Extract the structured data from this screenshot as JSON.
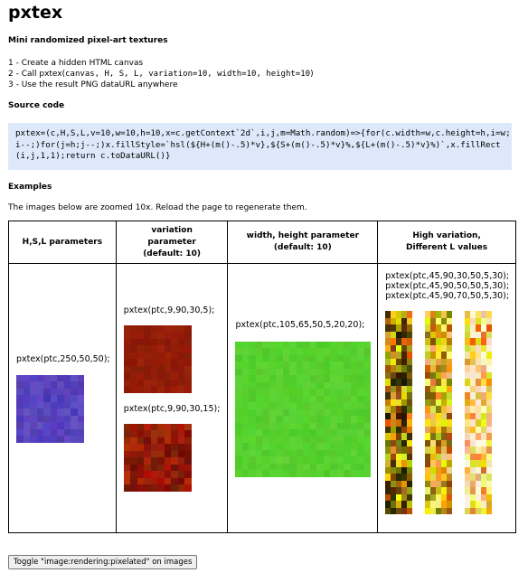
{
  "title": "pxtex",
  "subtitle": "Mini randomized pixel-art textures",
  "steps": {
    "s1": "1 - Create a hidden HTML canvas",
    "s2_prefix": "2 - Call pxtex(",
    "s2_args": "canvas, H, S, L, variation=10, width=10, height=10",
    "s2_suffix": ")",
    "s3": "3 - Use the result PNG dataURL anywhere"
  },
  "source_heading": "Source code",
  "source_code": "pxtex=(c,H,S,L,v=10,w=10,h=10,x=c.getContext`2d`,i,j,m=Math.random)=>{for(c.width=w,c.height=h,i=w;i--;)for(j=h;j--;)x.fillStyle=`hsl(${H+(m()-.5)*v},${S+(m()-.5)*v}%,${L+(m()-.5)*v}%)`,x.fillRect(i,j,1,1);return c.toDataURL()}",
  "examples_heading": "Examples",
  "zoom_note": "The images below are zoomed 10x. Reload the page to regenerate them.",
  "table": {
    "headers": {
      "hsl": "H,S,L parameters",
      "variation": "variation parameter (default: 10)",
      "size": "width, height parameter (default: 10)",
      "high": "High variation, Different L values"
    },
    "cells": {
      "hsl_call": "pxtex(ptc,250,50,50);",
      "var_call_1": "pxtex(ptc,9,90,30,5);",
      "var_call_2": "pxtex(ptc,9,90,30,15);",
      "size_call": "pxtex(ptc,105,65,50,5,20,20);",
      "high_call_1": "pxtex(ptc,45,90,30,50,5,30);",
      "high_call_2": "pxtex(ptc,45,90,50,50,5,30);",
      "high_call_3": "pxtex(ptc,45,90,70,50,5,30);"
    }
  },
  "toggle_button": "Toggle \"image:rendering:pixelated\" on images",
  "textures": [
    {
      "id": "tex-hsl",
      "H": 250,
      "S": 50,
      "L": 50,
      "v": 10,
      "w": 10,
      "h": 10
    },
    {
      "id": "tex-var-1",
      "H": 9,
      "S": 90,
      "L": 30,
      "v": 5,
      "w": 10,
      "h": 10
    },
    {
      "id": "tex-var-2",
      "H": 9,
      "S": 90,
      "L": 30,
      "v": 15,
      "w": 10,
      "h": 10
    },
    {
      "id": "tex-size",
      "H": 105,
      "S": 65,
      "L": 50,
      "v": 5,
      "w": 20,
      "h": 20
    },
    {
      "id": "tex-high-1",
      "H": 45,
      "S": 90,
      "L": 30,
      "v": 50,
      "w": 5,
      "h": 30
    },
    {
      "id": "tex-high-2",
      "H": 45,
      "S": 90,
      "L": 50,
      "v": 50,
      "w": 5,
      "h": 30
    },
    {
      "id": "tex-high-3",
      "H": 45,
      "S": 90,
      "L": 70,
      "v": 50,
      "w": 5,
      "h": 30
    }
  ]
}
